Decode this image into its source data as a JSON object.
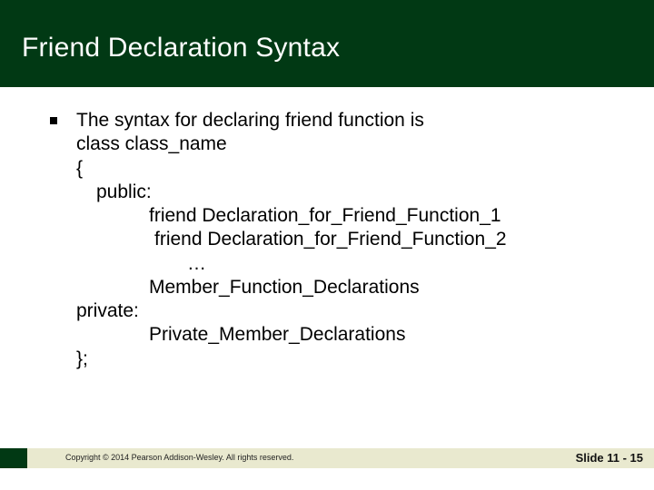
{
  "title": "Friend Declaration Syntax",
  "body": {
    "intro": "The syntax for declaring friend function is",
    "line_class": "class class_name",
    "line_open": "{",
    "line_public": "public:",
    "line_friend1": "friend Declaration_for_Friend_Function_1",
    "line_friend2": "friend Declaration_for_Friend_Function_2",
    "line_dots": "…",
    "line_member": "Member_Function_Declarations",
    "line_private": "private:",
    "line_privmember": "Private_Member_Declarations",
    "line_close": "};"
  },
  "footer": {
    "copyright": "Copyright © 2014 Pearson Addison-Wesley.  All rights reserved.",
    "slide_number": "Slide 11 - 15"
  }
}
